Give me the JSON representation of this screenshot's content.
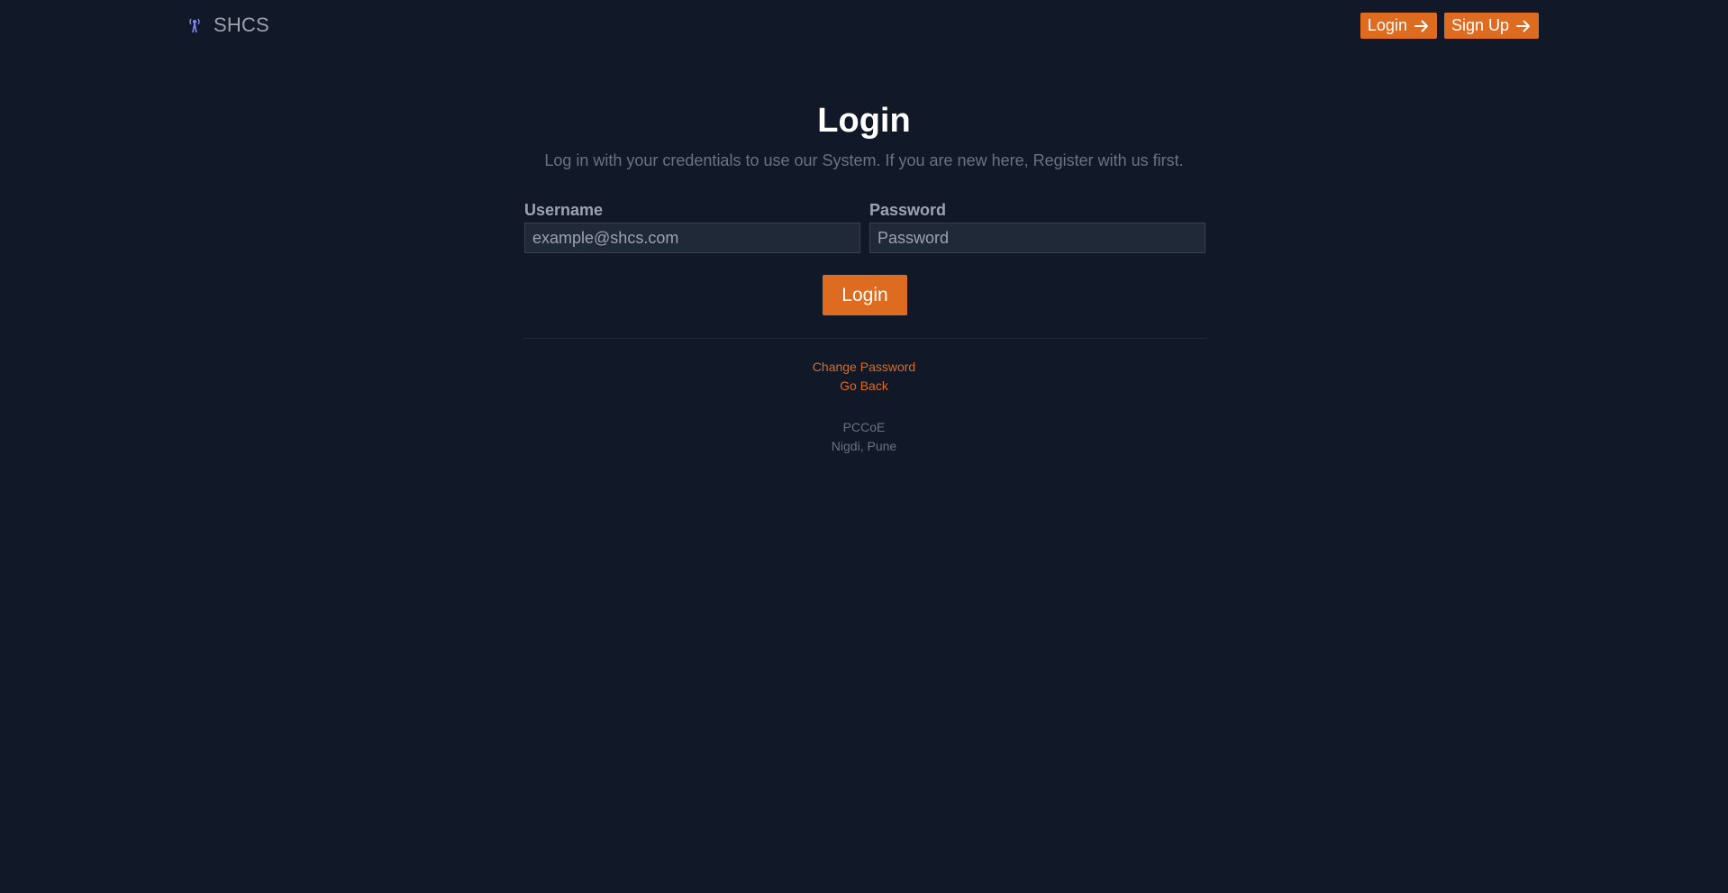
{
  "header": {
    "brand_name": "SHCS",
    "brand_icon": "tower-icon",
    "nav": {
      "login_label": "Login",
      "signup_label": "Sign Up",
      "arrow_icon": "arrow-right-icon"
    }
  },
  "main": {
    "title": "Login",
    "subtitle": "Log in with your credentials to use our System. If you are new here, Register with us first.",
    "username": {
      "label": "Username",
      "placeholder": "example@shcs.com",
      "value": ""
    },
    "password": {
      "label": "Password",
      "placeholder": "Password",
      "value": ""
    },
    "submit_label": "Login",
    "links": {
      "change_password": "Change Password",
      "go_back": "Go Back"
    },
    "footer": {
      "line1": "PCCoE",
      "line2": "Nigdi, Pune"
    }
  },
  "colors": {
    "background": "#111827",
    "accent": "#dd6b20",
    "input_background": "#1f2937",
    "muted_text": "#6b7280",
    "label_text": "#9ca3af",
    "brand_icon": "#818cf8"
  }
}
